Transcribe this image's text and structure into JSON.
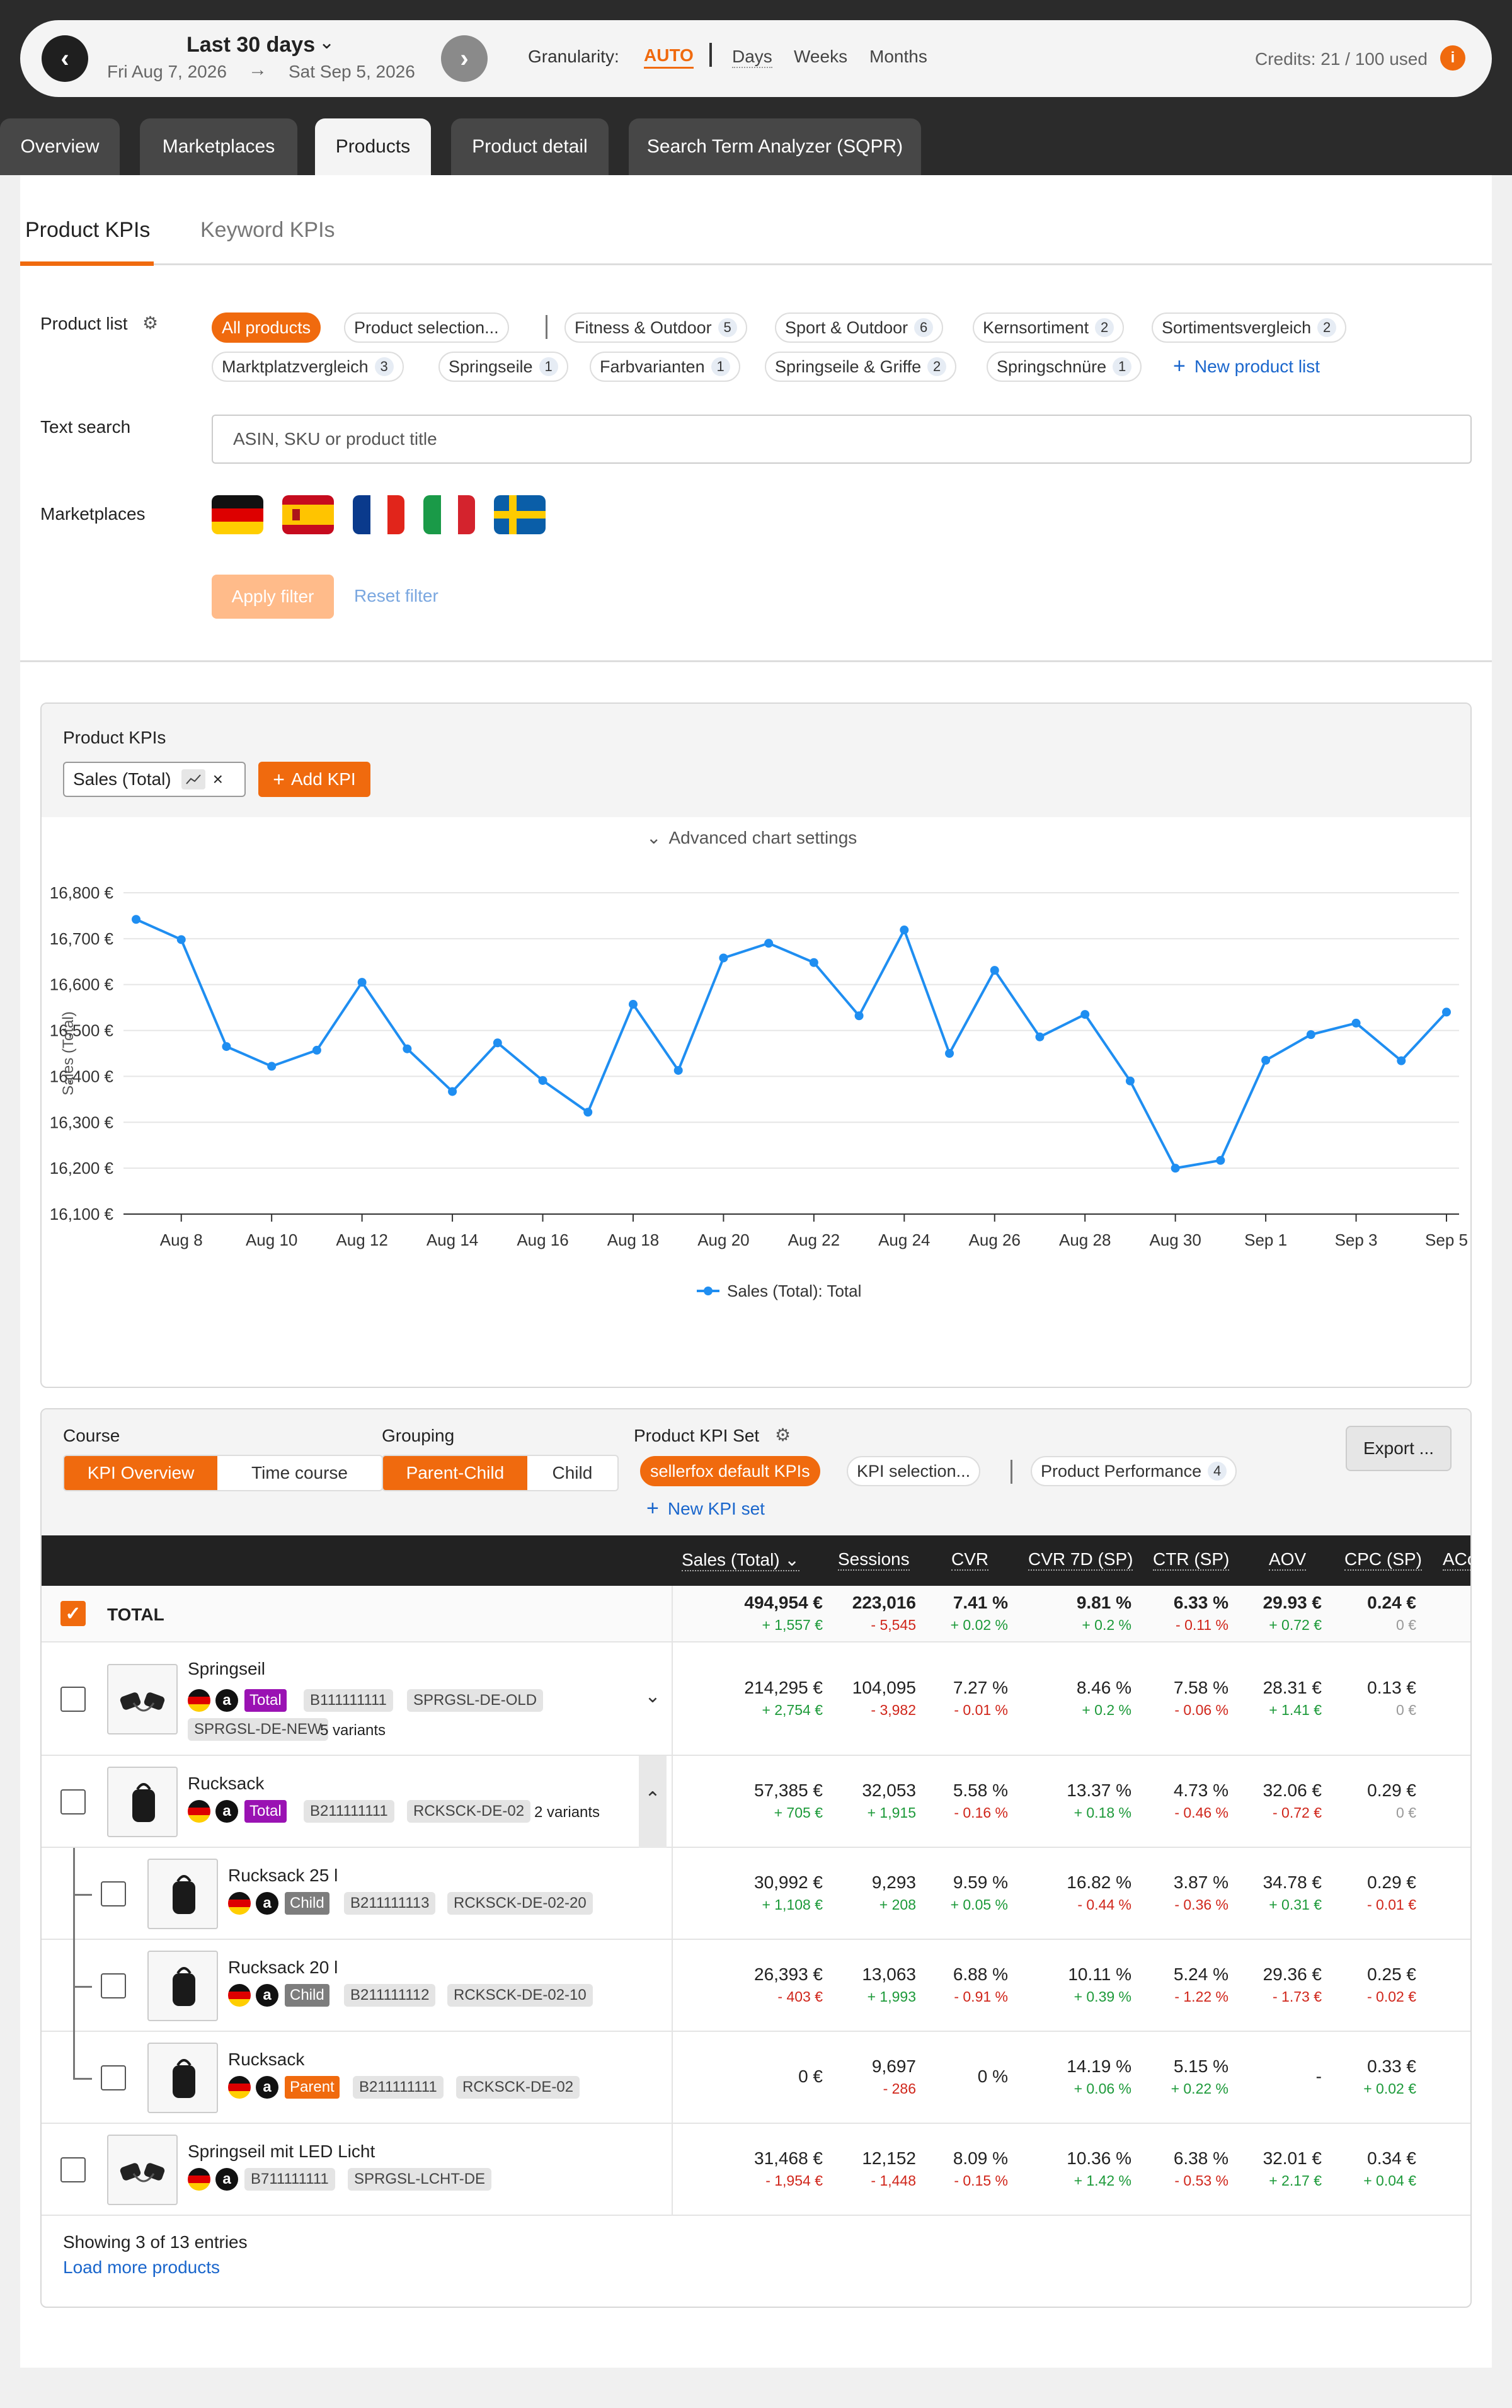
{
  "header": {
    "range_label": "Last 30 days",
    "date_from": "Fri Aug 7, 2026",
    "date_to": "Sat Sep 5, 2026",
    "granularity_label": "Granularity:",
    "granularity_options": [
      "AUTO",
      "Days",
      "Weeks",
      "Months"
    ],
    "granularity_selected": "AUTO",
    "credits": "Credits: 21 / 100 used",
    "credits_info": "i"
  },
  "main_tabs": [
    {
      "label": "Overview"
    },
    {
      "label": "Marketplaces"
    },
    {
      "label": "Products",
      "active": true
    },
    {
      "label": "Product detail"
    },
    {
      "label": "Search Term Analyzer (SQPR)"
    }
  ],
  "sub_tabs": [
    {
      "label": "Product KPIs",
      "active": true
    },
    {
      "label": "Keyword KPIs"
    }
  ],
  "filter": {
    "product_list_label": "Product list",
    "product_lists": [
      {
        "label": "All products",
        "active": true
      },
      {
        "label": "Product selection..."
      },
      {
        "label": "Fitness & Outdoor",
        "count": "5"
      },
      {
        "label": "Sport & Outdoor",
        "count": "6"
      },
      {
        "label": "Kernsortiment",
        "count": "2"
      },
      {
        "label": "Sortimentsvergleich",
        "count": "2"
      },
      {
        "label": "Marktplatzvergleich",
        "count": "3"
      },
      {
        "label": "Springseile",
        "count": "1"
      },
      {
        "label": "Farbvarianten",
        "count": "1"
      },
      {
        "label": "Springseile & Griffe",
        "count": "2"
      },
      {
        "label": "Springschnüre",
        "count": "1"
      }
    ],
    "new_product_list": "New product list",
    "text_search_label": "Text search",
    "text_search_placeholder": "ASIN, SKU or product title",
    "marketplaces_label": "Marketplaces",
    "marketplaces": [
      "DE",
      "ES",
      "FR",
      "IT",
      "SE"
    ],
    "apply_label": "Apply filter",
    "reset_label": "Reset filter"
  },
  "chart_section": {
    "title": "Product KPIs",
    "kpi_chip": "Sales (Total)",
    "add_kpi": "Add KPI",
    "advanced_settings": "Advanced chart settings"
  },
  "chart_data": {
    "type": "line",
    "ylabel": "Sales (Total)",
    "xlabel": "",
    "y_ticks": [
      "16,100 €",
      "16,200 €",
      "16,300 €",
      "16,400 €",
      "16,500 €",
      "16,600 €",
      "16,700 €",
      "16,800 €"
    ],
    "ylim": [
      16100,
      16800
    ],
    "x_ticks": [
      "Aug 8",
      "Aug 10",
      "Aug 12",
      "Aug 14",
      "Aug 16",
      "Aug 18",
      "Aug 20",
      "Aug 22",
      "Aug 24",
      "Aug 26",
      "Aug 28",
      "Aug 30",
      "Sep 1",
      "Sep 3",
      "Sep 5"
    ],
    "x": [
      "Aug 7",
      "Aug 8",
      "Aug 9",
      "Aug 10",
      "Aug 11",
      "Aug 12",
      "Aug 13",
      "Aug 14",
      "Aug 15",
      "Aug 16",
      "Aug 17",
      "Aug 18",
      "Aug 19",
      "Aug 20",
      "Aug 21",
      "Aug 22",
      "Aug 23",
      "Aug 24",
      "Aug 25",
      "Aug 26",
      "Aug 27",
      "Aug 28",
      "Aug 29",
      "Aug 30",
      "Aug 31",
      "Sep 1",
      "Sep 2",
      "Sep 3",
      "Sep 4",
      "Sep 5"
    ],
    "series": [
      {
        "name": "Sales (Total): Total",
        "color": "#1f8ef1",
        "values": [
          16742,
          16698,
          16465,
          16422,
          16457,
          16605,
          16460,
          16367,
          16473,
          16391,
          16322,
          16557,
          16413,
          16658,
          16690,
          16648,
          16532,
          16719,
          16450,
          16631,
          16486,
          16535,
          16390,
          16200,
          16217,
          16435,
          16491,
          16516,
          16434,
          16540
        ]
      }
    ],
    "grid": true,
    "legend": "bottom-center"
  },
  "table_section": {
    "course_label": "Course",
    "course_options": [
      "KPI Overview",
      "Time course"
    ],
    "grouping_label": "Grouping",
    "grouping_options": [
      "Parent-Child",
      "Child"
    ],
    "kpi_set_label": "Product KPI Set",
    "kpi_sets": [
      {
        "label": "sellerfox default KPIs",
        "active": true
      },
      {
        "label": "KPI selection..."
      },
      {
        "label": "Product Performance",
        "count": "4"
      }
    ],
    "new_kpi_set": "New KPI set",
    "export": "Export ..."
  },
  "table": {
    "columns": [
      "Sales (Total)",
      "Sessions",
      "CVR",
      "CVR 7D (SP)",
      "CTR (SP)",
      "AOV",
      "CPC (SP)",
      "ACoS"
    ],
    "total": {
      "label": "TOTAL",
      "values": [
        "494,954 €",
        "223,016",
        "7.41 %",
        "9.81 %",
        "6.33 %",
        "29.93 €",
        "0.24 €"
      ],
      "deltas": [
        "+ 1,557 €",
        "- 5,545",
        "+ 0.02 %",
        "+ 0.2 %",
        "- 0.11 %",
        "+ 0.72 €",
        "0 €"
      ]
    },
    "rows": [
      {
        "name": "Springseil",
        "badge": "Total",
        "asin": "B111111111",
        "skus": [
          "SPRGSL-DE-OLD",
          "SPRGSL-DE-NEW"
        ],
        "variants": "5 variants",
        "values": [
          "214,295 €",
          "104,095",
          "7.27 %",
          "8.46 %",
          "7.58 %",
          "28.31 €",
          "0.13 €"
        ],
        "deltas": [
          "+ 2,754 €",
          "- 3,982",
          "- 0.01 %",
          "+ 0.2 %",
          "- 0.06 %",
          "+ 1.41 €",
          "0 €"
        ]
      },
      {
        "name": "Rucksack",
        "badge": "Total",
        "asin": "B211111111",
        "skus": [
          "RCKSCK-DE-02"
        ],
        "variants": "2 variants",
        "values": [
          "57,385 €",
          "32,053",
          "5.58 %",
          "13.37 %",
          "4.73 %",
          "32.06 €",
          "0.29 €"
        ],
        "deltas": [
          "+ 705 €",
          "+ 1,915",
          "- 0.16 %",
          "+ 0.18 %",
          "- 0.46 %",
          "- 0.72 €",
          "0 €"
        ]
      },
      {
        "name": "Rucksack 25 l",
        "badge": "Child",
        "asin": "B211111113",
        "skus": [
          "RCKSCK-DE-02-20"
        ],
        "variants": "",
        "values": [
          "30,992 €",
          "9,293",
          "9.59 %",
          "16.82 %",
          "3.87 %",
          "34.78 €",
          "0.29 €"
        ],
        "deltas": [
          "+ 1,108 €",
          "+ 208",
          "+ 0.05 %",
          "- 0.44 %",
          "- 0.36 %",
          "+ 0.31 €",
          "- 0.01 €"
        ]
      },
      {
        "name": "Rucksack 20 l",
        "badge": "Child",
        "asin": "B211111112",
        "skus": [
          "RCKSCK-DE-02-10"
        ],
        "variants": "",
        "values": [
          "26,393 €",
          "13,063",
          "6.88 %",
          "10.11 %",
          "5.24 %",
          "29.36 €",
          "0.25 €"
        ],
        "deltas": [
          "- 403 €",
          "+ 1,993",
          "- 0.91 %",
          "+ 0.39 %",
          "- 1.22 %",
          "- 1.73 €",
          "- 0.02 €"
        ]
      },
      {
        "name": "Rucksack",
        "badge": "Parent",
        "asin": "B211111111",
        "skus": [
          "RCKSCK-DE-02"
        ],
        "variants": "",
        "values": [
          "0 €",
          "9,697",
          "0 %",
          "14.19 %",
          "5.15 %",
          "-",
          "0.33 €"
        ],
        "deltas": [
          "",
          "- 286",
          "",
          "+ 0.06 %",
          "+ 0.22 %",
          "",
          "+ 0.02 €"
        ]
      },
      {
        "name": "Springseil mit LED Licht",
        "badge": "",
        "asin": "B711111111",
        "skus": [
          "SPRGSL-LCHT-DE"
        ],
        "variants": "",
        "values": [
          "31,468 €",
          "12,152",
          "8.09 %",
          "10.36 %",
          "6.38 %",
          "32.01 €",
          "0.34 €"
        ],
        "deltas": [
          "- 1,954 €",
          "- 1,448",
          "- 0.15 %",
          "+ 1.42 %",
          "- 0.53 %",
          "+ 2.17 €",
          "+ 0.04 €"
        ]
      }
    ],
    "showing": "Showing 3 of 13 entries",
    "load_more": "Load more products"
  }
}
